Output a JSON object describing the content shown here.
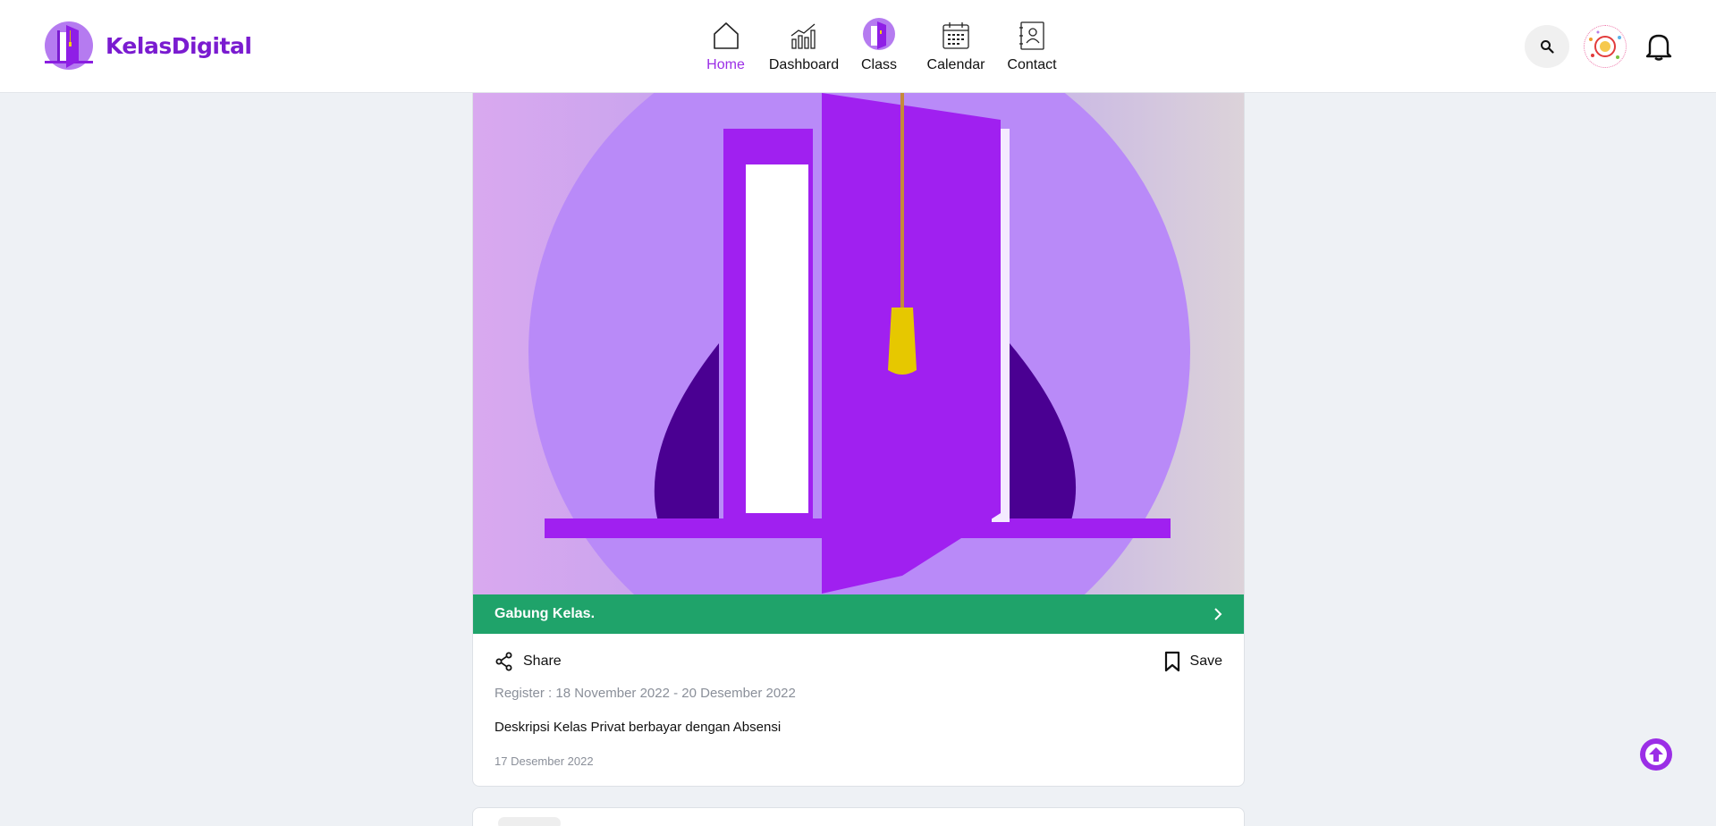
{
  "brand": {
    "name": "KelasDigital",
    "accent": "#9b2ee6",
    "success": "#1fa36a"
  },
  "nav": {
    "items": [
      {
        "label": "Home",
        "icon": "home-icon",
        "active": true
      },
      {
        "label": "Dashboard",
        "icon": "chart-icon"
      },
      {
        "label": "Class",
        "icon": "class-door-icon"
      },
      {
        "label": "Calendar",
        "icon": "calendar-icon"
      },
      {
        "label": "Contact",
        "icon": "contact-book-icon"
      }
    ]
  },
  "header_actions": {
    "search_icon": "search-icon",
    "avatar_icon": "user-avatar",
    "bell_icon": "bell-icon"
  },
  "card": {
    "join_label": "Gabung Kelas.",
    "share_label": "Share",
    "save_label": "Save",
    "register": "Register : 18 November 2022 - 20 Desember 2022",
    "description": "Deskripsi Kelas Privat berbayar dengan Absensi",
    "date": "17 Desember 2022"
  }
}
